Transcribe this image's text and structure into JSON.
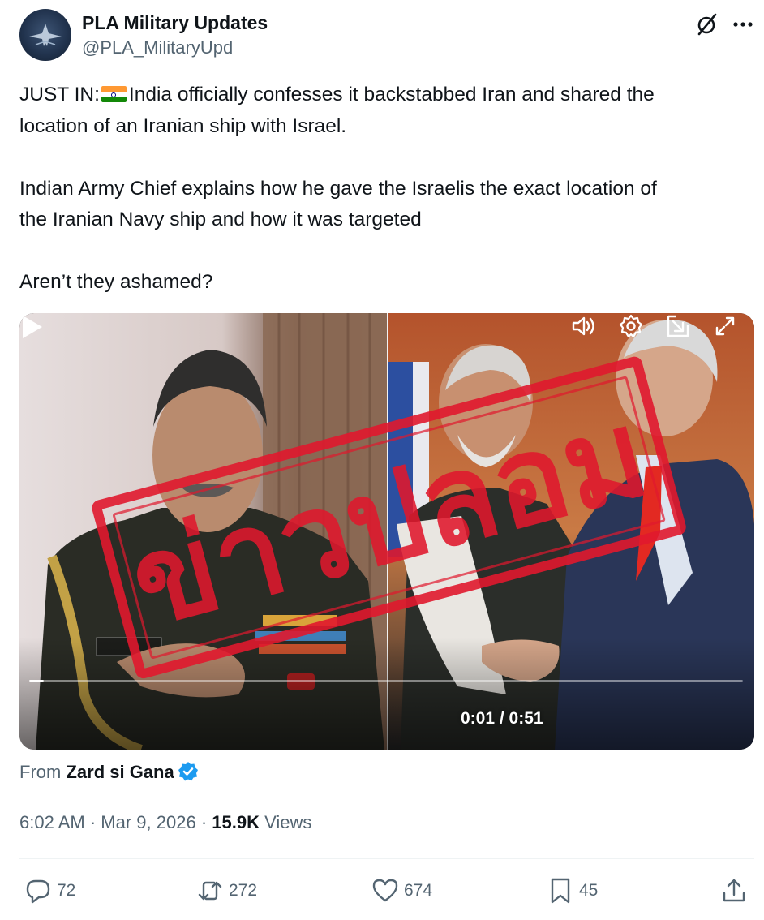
{
  "post": {
    "author_name": "PLA Military Updates",
    "author_handle": "@PLA_MilitaryUpd",
    "text_line1_prefix": "JUST IN:",
    "text_line1_rest": "India officially confesses it backstabbed Iran and shared the",
    "text_line2": "location of an Iranian ship with Israel.",
    "text_line3": "Indian Army Chief explains how he gave the Israelis the exact location of",
    "text_line4": "the Iranian Navy ship and how it was targeted",
    "text_line5": "Aren’t they ashamed?",
    "flag_emoji": "india-flag",
    "stamp_text": "ข่าวปลอม"
  },
  "video": {
    "current_time": "0:01",
    "duration": "0:51",
    "time_display": "0:01 / 0:51",
    "progress": 0.02
  },
  "source": {
    "prefix": "From",
    "name": "Zard si Gana",
    "verified": true
  },
  "meta": {
    "time": "6:02 AM",
    "separator": "·",
    "date": "Mar 9, 2026",
    "views_count": "15.9K",
    "views_label": "Views"
  },
  "actions": {
    "replies": "72",
    "reposts": "272",
    "likes": "674",
    "bookmarks": "45"
  },
  "colors": {
    "text": "#0f1419",
    "secondary": "#536471",
    "verified_blue": "#1d9bf0",
    "stamp_red": "#e0182d"
  }
}
